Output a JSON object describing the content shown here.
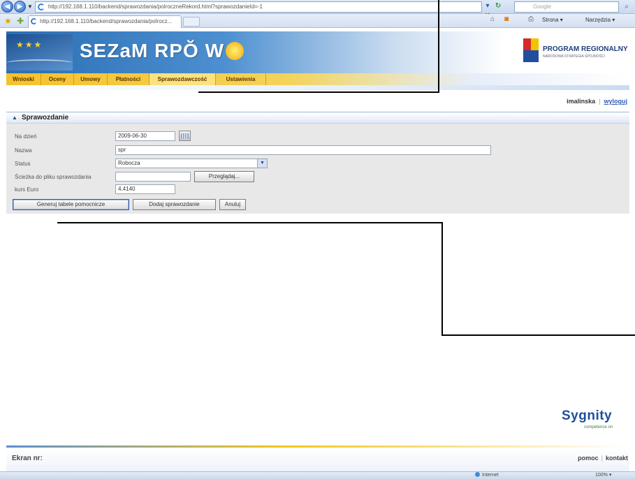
{
  "browser": {
    "address": "http://192.168.1.110/backend/sprawozdania/polroczneRekord.html?sprawozdanieId=-1",
    "search_placeholder": "Google",
    "tab_title": "http://192.168.1.110/backend/sprawozdania/polrocz...",
    "commands": {
      "page": "Strona",
      "tools": "Narzędzia"
    },
    "status": {
      "zone": "Internet",
      "zoom": "100%"
    }
  },
  "app": {
    "brand": "SEZaM RPO WO",
    "brand_parts": {
      "pre": "SEZaM RPŎ W"
    },
    "program_logo": {
      "title": "PROGRAM REGIONALNY",
      "subtitle": "NARODOWA STRATEGIA SPÓJNOŚCI"
    },
    "menu": [
      "Wnioski",
      "Oceny",
      "Umowy",
      "Płatności",
      "Sprawozdawczość",
      "Ustawienia"
    ],
    "active_menu": "Sprawozdawczość",
    "user": {
      "name": "imalinska",
      "logout": "wyloguj"
    }
  },
  "panel": {
    "title": "Sprawozdanie",
    "fields": {
      "date_label": "Na dzień",
      "date_value": "2009-06-30",
      "name_label": "Nazwa",
      "name_value": "spr",
      "status_label": "Status",
      "status_value": "Robocza",
      "file_label": "Ścieżka do pliku sprawozdania",
      "file_value": "",
      "browse": "Przeglądaj...",
      "euro_label": "kurs Euro",
      "euro_value": "4.4140"
    },
    "buttons": {
      "generate": "Generuj tabele pomocnicze",
      "add": "Dodaj sprawozdanie",
      "cancel": "Anuluj"
    }
  },
  "footer": {
    "screen_label": "Ekran nr:",
    "help": "pomoc",
    "contact": "kontakt",
    "vendor": "Sygnity",
    "vendor_tagline": "competence on"
  },
  "colors": {
    "accent_blue": "#2a6fb4",
    "menu_yellow": "#f6c12c",
    "panel_bg": "#e8e8e8"
  }
}
